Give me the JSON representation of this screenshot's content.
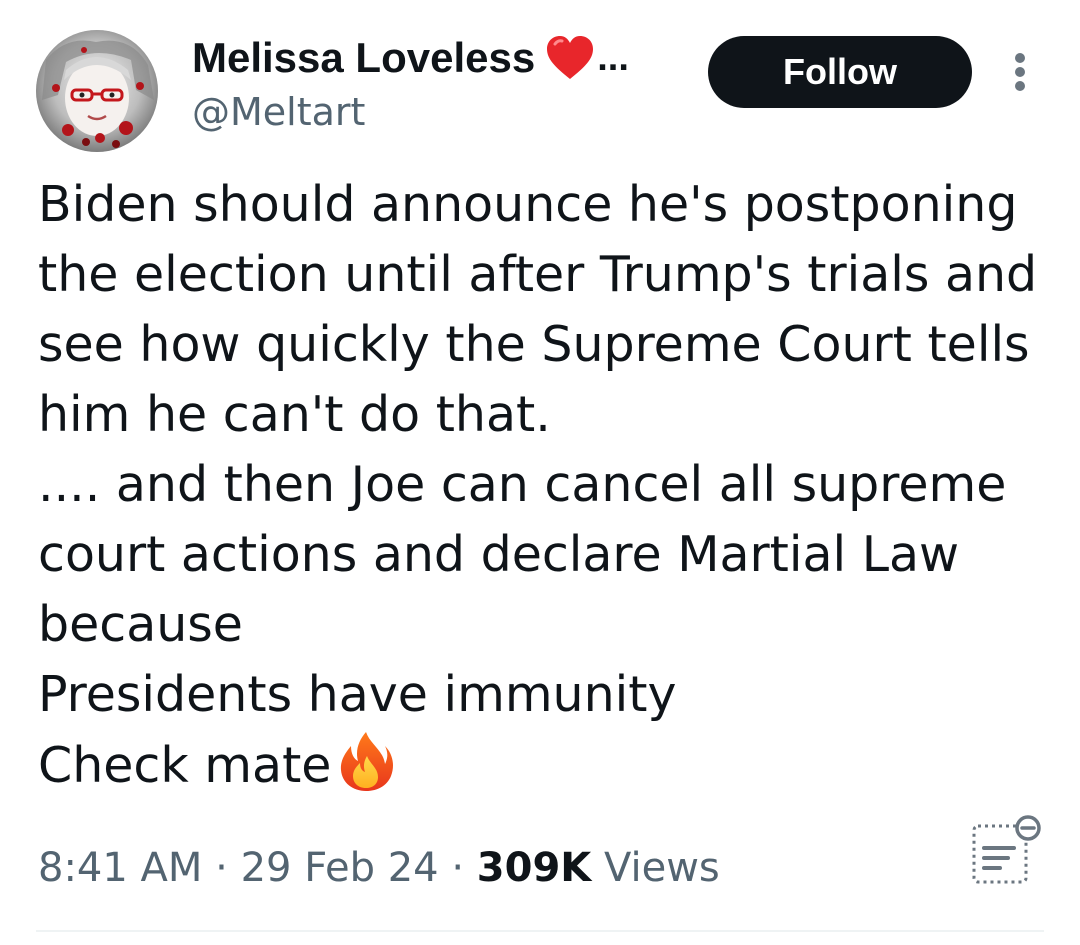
{
  "author": {
    "display_name": "Melissa Loveless",
    "name_ellipsis": "...",
    "handle": "@Meltart",
    "heart_color": "#e8262b",
    "avatar_icon": "user-avatar-photo"
  },
  "actions": {
    "follow_label": "Follow",
    "more_icon": "more-vertical-icon"
  },
  "tweet": {
    "lines": [
      "Biden should announce he's postponing",
      "the election until after Trump's trials and",
      "see how quickly the Supreme Court tells",
      "him he can't do that.",
      ".... and then Joe can cancel all supreme",
      "court actions and declare Martial Law",
      "because",
      "Presidents have immunity",
      "Check mate"
    ],
    "trailing_emoji": "fire-icon"
  },
  "meta": {
    "time": "8:41 AM",
    "separator": " · ",
    "date": "29 Feb 24",
    "views_count": "309K",
    "views_label": "Views",
    "analytics_icon": "analytics-icon"
  },
  "colors": {
    "text_primary": "#0f1419",
    "text_secondary": "#536471",
    "button_bg": "#0f1419",
    "divider": "#eff3f4"
  }
}
